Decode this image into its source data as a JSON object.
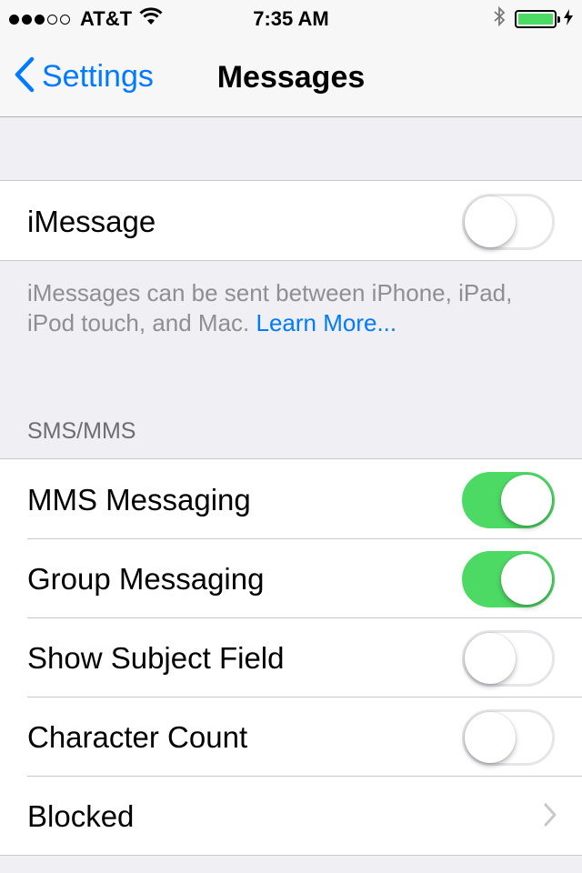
{
  "status_bar": {
    "signal_dots_full": 3,
    "signal_dots_empty": 2,
    "carrier": "AT&T",
    "time": "7:35 AM",
    "battery_level": 1.0,
    "battery_color": "#4cd964"
  },
  "nav": {
    "back_label": "Settings",
    "title": "Messages"
  },
  "imessage": {
    "label": "iMessage",
    "on": false
  },
  "footer": {
    "text": "iMessages can be sent between iPhone, iPad, iPod touch, and Mac.",
    "link": "Learn More..."
  },
  "sms_section": {
    "header": "SMS/MMS",
    "rows": [
      {
        "label": "MMS Messaging",
        "type": "switch",
        "on": true
      },
      {
        "label": "Group Messaging",
        "type": "switch",
        "on": true
      },
      {
        "label": "Show Subject Field",
        "type": "switch",
        "on": false
      },
      {
        "label": "Character Count",
        "type": "switch",
        "on": false
      },
      {
        "label": "Blocked",
        "type": "disclosure"
      }
    ]
  },
  "colors": {
    "accent": "#007aff",
    "switch_on": "#4cd964",
    "background": "#efeff4"
  }
}
